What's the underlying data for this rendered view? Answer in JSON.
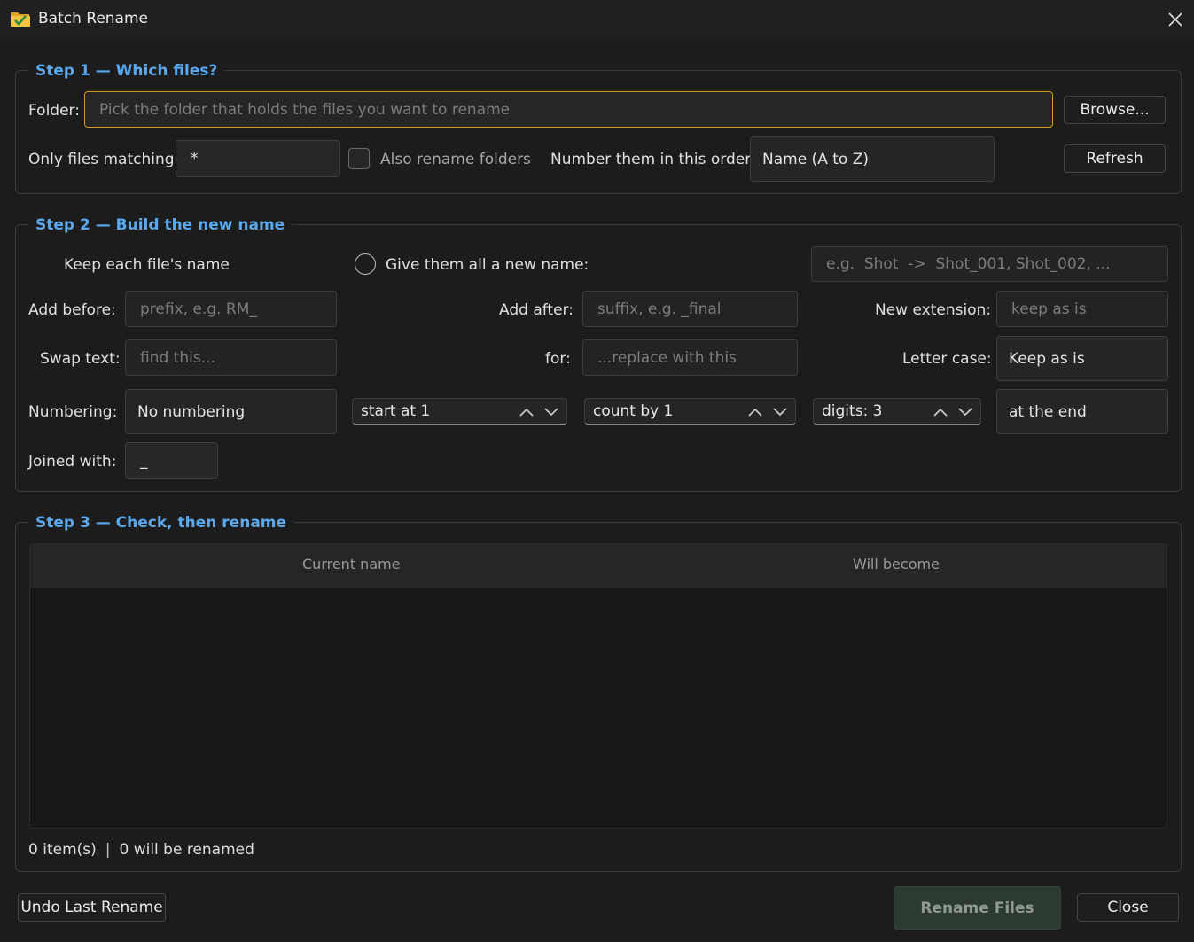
{
  "window": {
    "title": "Batch Rename"
  },
  "step1": {
    "title": "Step 1 — Which files?",
    "folder_label": "Folder:",
    "folder_placeholder": "Pick the folder that holds the files you want to rename",
    "browse_label": "Browse...",
    "matching_label": "Only files matching:",
    "matching_value": "*",
    "also_folders_label": "Also rename folders",
    "order_label": "Number them in this order:",
    "order_value": "Name (A to Z)",
    "refresh_label": "Refresh"
  },
  "step2": {
    "title": "Step 2 — Build the new name",
    "keep_name_label": "Keep each file's name",
    "new_name_label": "Give them all a new name:",
    "new_name_placeholder": "e.g.  Shot  ->  Shot_001, Shot_002, ...",
    "add_before_label": "Add before:",
    "add_before_placeholder": "prefix, e.g. RM_",
    "add_after_label": "Add after:",
    "add_after_placeholder": "suffix, e.g. _final",
    "new_ext_label": "New extension:",
    "new_ext_placeholder": "keep as is",
    "swap_label": "Swap text:",
    "swap_placeholder": "find this...",
    "for_label": "for:",
    "replace_placeholder": "...replace with this",
    "case_label": "Letter case:",
    "case_value": "Keep as is",
    "numbering_label": "Numbering:",
    "numbering_value": "No numbering",
    "start_value": "start at 1",
    "count_value": "count by 1",
    "digits_value": "digits: 3",
    "position_value": "at the end",
    "joined_label": "Joined with:",
    "joined_value": "_"
  },
  "step3": {
    "title": "Step 3 — Check, then rename",
    "columns": [
      "Current name",
      "Will become"
    ],
    "items_count": "0 item(s)",
    "separator": "|",
    "will_rename": "0 will be renamed"
  },
  "footer": {
    "undo_label": "Undo Last Rename",
    "rename_label": "Rename Files",
    "close_label": "Close"
  },
  "colors": {
    "accent": "#5aa9f0",
    "focus": "#d4962b",
    "background": "#1c1c1c"
  },
  "icons": {
    "app": "folder-check-icon",
    "close": "close-icon",
    "spin_up": "chevron-up-icon",
    "spin_down": "chevron-down-icon"
  }
}
